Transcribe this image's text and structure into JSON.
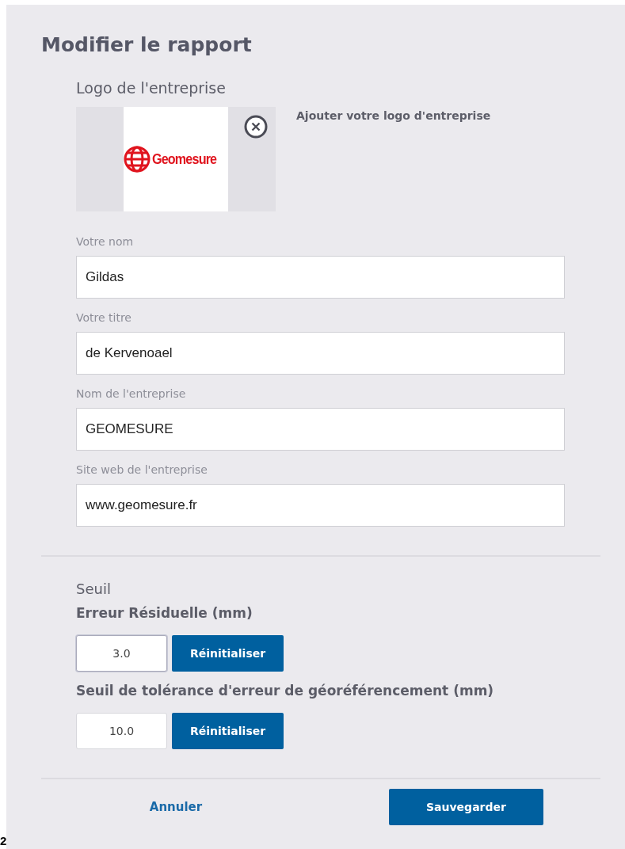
{
  "dialog": {
    "title": "Modifier le rapport"
  },
  "logo_section": {
    "heading": "Logo de l'entreprise",
    "logo_text": "Geomesure",
    "add_label": "Ajouter votre logo d'entreprise"
  },
  "fields": [
    {
      "label": "Votre nom",
      "value": "Gildas"
    },
    {
      "label": "Votre titre",
      "value": "de Kervenoael"
    },
    {
      "label": "Nom de l'entreprise",
      "value": "GEOMESURE"
    },
    {
      "label": "Site web de l'entreprise",
      "value": "www.geomesure.fr"
    }
  ],
  "threshold": {
    "heading": "Seuil",
    "items": [
      {
        "label": "Erreur Résiduelle (mm)",
        "value": "3.0",
        "focused": true,
        "button": "Réinitialiser"
      },
      {
        "label": "Seuil de tolérance d'erreur de géoréférencement  (mm)",
        "value": "10.0",
        "focused": false,
        "button": "Réinitialiser"
      }
    ]
  },
  "footer": {
    "cancel": "Annuler",
    "save": "Sauvegarder"
  },
  "page_number": "2"
}
